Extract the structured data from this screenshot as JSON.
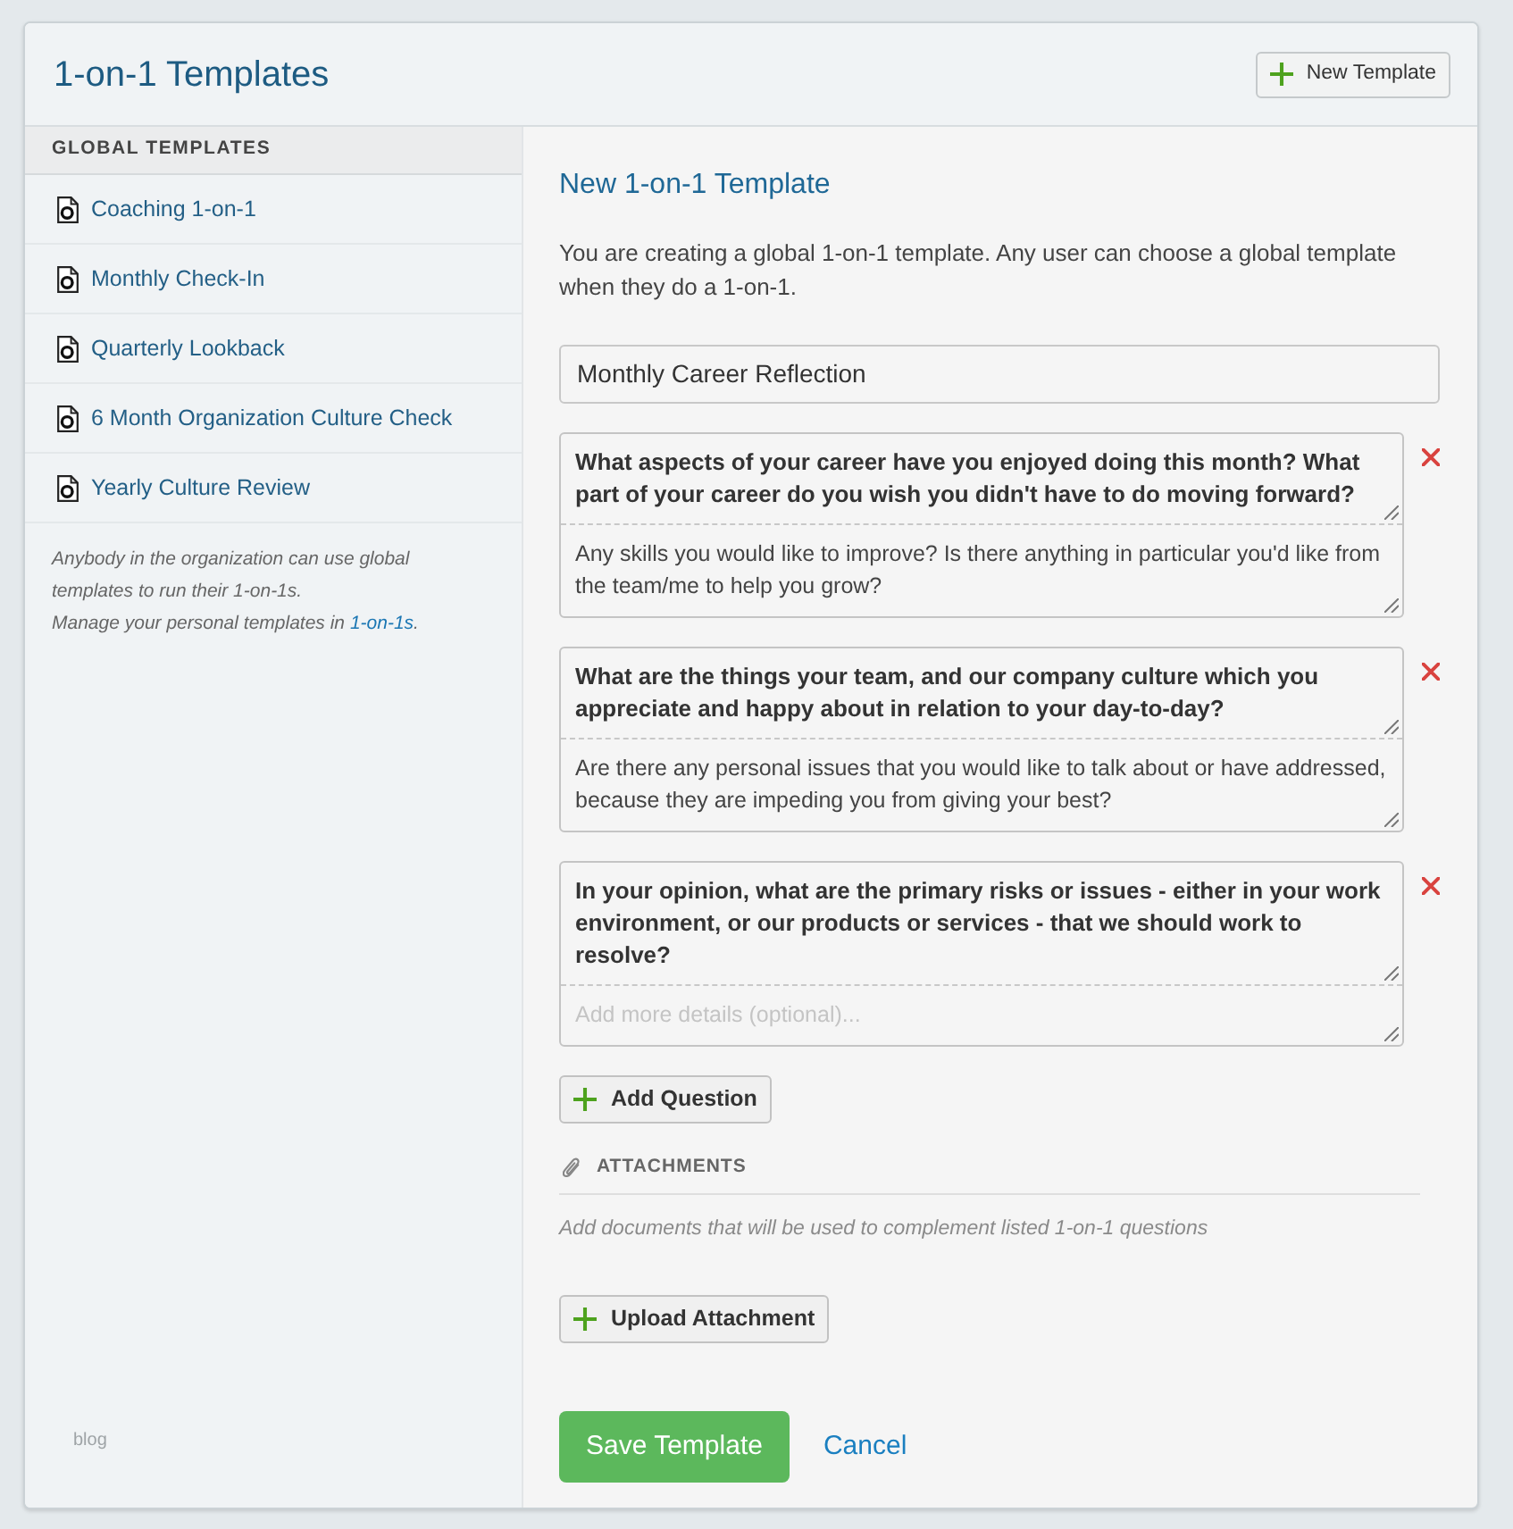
{
  "header": {
    "title": "1-on-1 Templates",
    "new_button": "New Template"
  },
  "sidebar": {
    "heading": "GLOBAL TEMPLATES",
    "items": [
      {
        "label": "Coaching 1-on-1"
      },
      {
        "label": "Monthly Check-In"
      },
      {
        "label": "Quarterly Lookback"
      },
      {
        "label": "6 Month Organization Culture Check"
      },
      {
        "label": "Yearly Culture Review"
      }
    ],
    "note": "Anybody in the organization can use global templates to run their 1-on-1s.",
    "manage_note": {
      "text": "Manage your personal templates in ",
      "link": "1-on-1s",
      "suffix": "."
    },
    "footer_link": "blog"
  },
  "form": {
    "title": "New 1-on-1 Template",
    "description": "You are creating a global 1-on-1 template. Any user can choose a global template when they do a 1-on-1.",
    "name_field": {
      "value": "Monthly Career Reflection"
    },
    "questions": [
      {
        "question": "What aspects of your career have you enjoyed doing this month? What part of your career do you wish you didn't have to do moving forward?",
        "details": "Any skills you would like to improve? Is there anything in particular you'd like from the team/me to help you grow?"
      },
      {
        "question": "What are the things your team, and our company culture which you appreciate and happy about in relation to your day-to-day?",
        "details": "Are there any personal issues that you would like to talk about or have addressed, because they are impeding you from giving your best?"
      },
      {
        "question": "In your opinion, what are the primary risks or issues - either in your work environment, or our products or services - that we should work to resolve?",
        "placeholder": "Add more details (optional)..."
      }
    ],
    "add_question": "Add Question",
    "attachments": {
      "heading": "ATTACHMENTS",
      "note": "Add documents that will be used to complement listed 1-on-1 questions",
      "upload_button": "Upload Attachment"
    },
    "save_button": "Save Template",
    "cancel_link": "Cancel"
  }
}
